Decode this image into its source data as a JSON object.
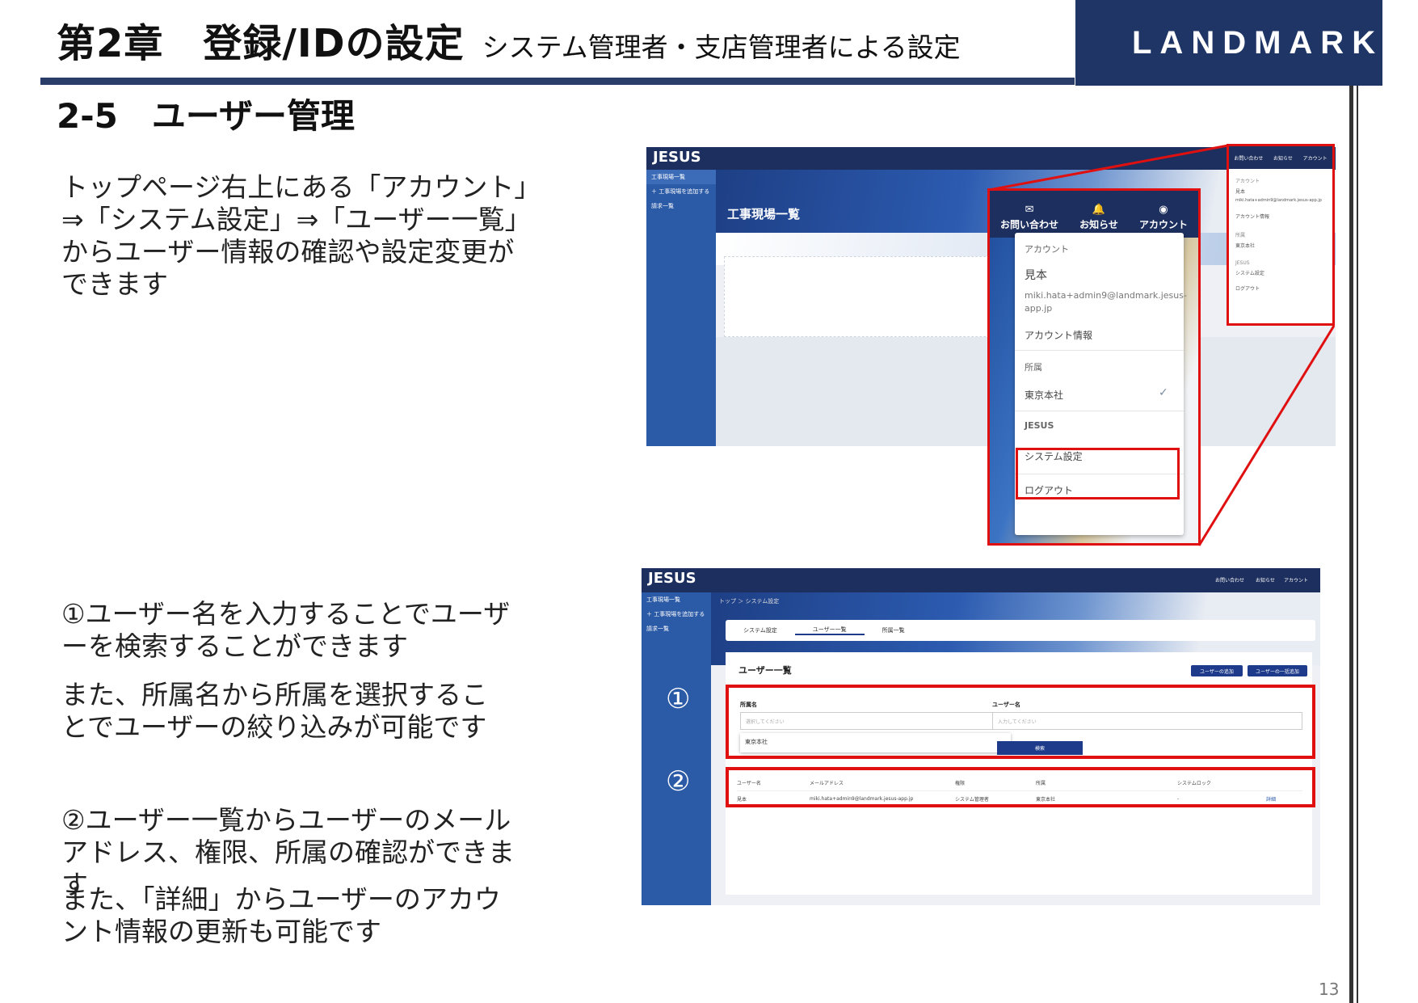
{
  "header": {
    "chapter_title": "第2章　登録/IDの設定",
    "chapter_subtitle": "システム管理者・支店管理者による設定",
    "logo_text": "LANDMARK"
  },
  "section_title": "2-5　ユーザー管理",
  "body": {
    "p1": "トップページ右上にある「アカウント」⇒「システム設定」⇒「ユーザー一覧」からユーザー情報の確認や設定変更ができます",
    "p2": "①ユーザー名を入力することでユーザーを検索することができます",
    "p3": "また、所属名から所属を選択することでユーザーの絞り込みが可能です",
    "p4": "②ユーザー一覧からユーザーのメールアドレス、権限、所属の確認ができます",
    "p5": "また、「詳細」からユーザーのアカウント情報の更新も可能です"
  },
  "page_number": "13",
  "screenshot1": {
    "brand": "JESUS",
    "sidebar": [
      "工事現場一覧",
      "＋ 工事現場を追加する",
      "請求一覧"
    ],
    "page_heading": "工事現場一覧",
    "topbar": {
      "contact": "お問い合わせ",
      "notice": "お知らせ",
      "account": "アカウント"
    },
    "menu": {
      "account_caption": "アカウント",
      "user_name": "見本",
      "email": "miki.hata+admin9@landmark.jesus-app.jp",
      "account_info": "アカウント情報",
      "affiliation_caption": "所属",
      "affiliation": "東京本社",
      "jesus_caption": "JESUS",
      "system_settings": "システム設定",
      "logout": "ログアウト"
    }
  },
  "screenshot2": {
    "brand": "JESUS",
    "sidebar": [
      "工事現場一覧",
      "＋ 工事現場を追加する",
      "請求一覧"
    ],
    "topbar": {
      "contact": "お問い合わせ",
      "notice": "お知らせ",
      "account": "アカウント"
    },
    "breadcrumb": "トップ ＞ システム設定",
    "tabs": [
      "システム設定",
      "ユーザー一覧",
      "所属一覧"
    ],
    "panel_title": "ユーザー一覧",
    "buttons": {
      "add_user": "ユーザーの追加",
      "bulk_add": "ユーザーの一括追加",
      "search": "検索"
    },
    "fields": {
      "affiliation_label": "所属名",
      "affiliation_placeholder": "選択してください",
      "username_label": "ユーザー名",
      "username_placeholder": "入力してください",
      "dropdown_option": "東京本社"
    },
    "table": {
      "headers": [
        "ユーザー名",
        "メールアドレス",
        "権限",
        "所属",
        "システムロック",
        ""
      ],
      "rows": [
        [
          "見本",
          "miki.hata+admin9@landmark.jesus-app.jp",
          "システム管理者",
          "東京本社",
          "-",
          "詳細"
        ]
      ]
    },
    "markers": {
      "one": "①",
      "two": "②"
    }
  },
  "colors": {
    "navy": "#1f3566",
    "accent_red": "#e01010",
    "sidebar_blue": "#2b5aa6"
  }
}
